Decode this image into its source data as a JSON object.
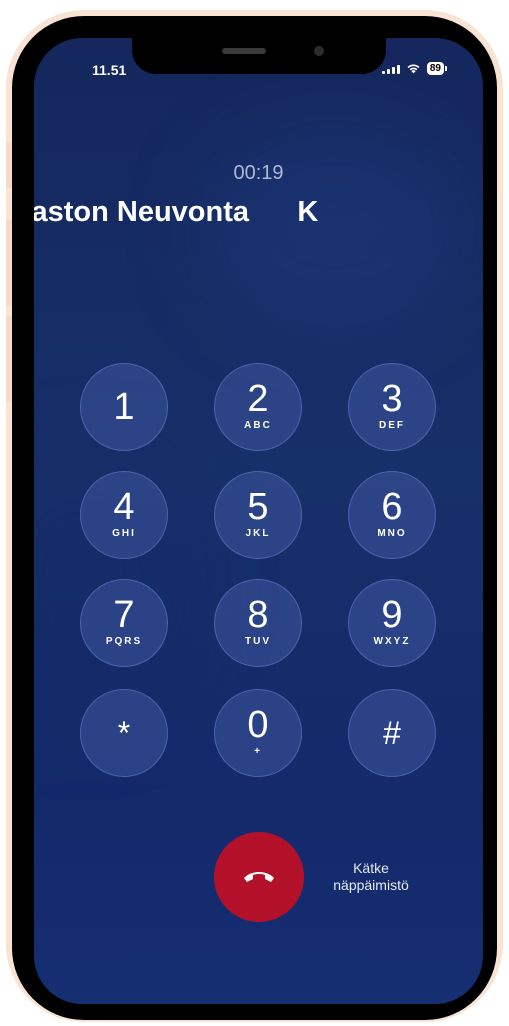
{
  "status_bar": {
    "time": "11.51",
    "battery": "89",
    "signal_icon": "signal-icon",
    "wifi_icon": "wifi-icon"
  },
  "call": {
    "duration": "00:19",
    "caller_name": "Verohallinto  Neuvontaviraston Neuvonta     K"
  },
  "keypad": [
    {
      "digit": "1",
      "letters": ""
    },
    {
      "digit": "2",
      "letters": "ABC"
    },
    {
      "digit": "3",
      "letters": "DEF"
    },
    {
      "digit": "4",
      "letters": "GHI"
    },
    {
      "digit": "5",
      "letters": "JKL"
    },
    {
      "digit": "6",
      "letters": "MNO"
    },
    {
      "digit": "7",
      "letters": "PQRS"
    },
    {
      "digit": "8",
      "letters": "TUV"
    },
    {
      "digit": "9",
      "letters": "WXYZ"
    },
    {
      "digit": "*",
      "letters": ""
    },
    {
      "digit": "0",
      "letters": "+"
    },
    {
      "digit": "#",
      "letters": ""
    }
  ],
  "actions": {
    "end_call_icon": "phone-hangup-icon",
    "hide_keypad_line1": "Kätke",
    "hide_keypad_line2": "näppäimistö"
  },
  "colors": {
    "background": "#16306a",
    "end_call": "#b3112a",
    "frame": "#f9e3d4"
  }
}
